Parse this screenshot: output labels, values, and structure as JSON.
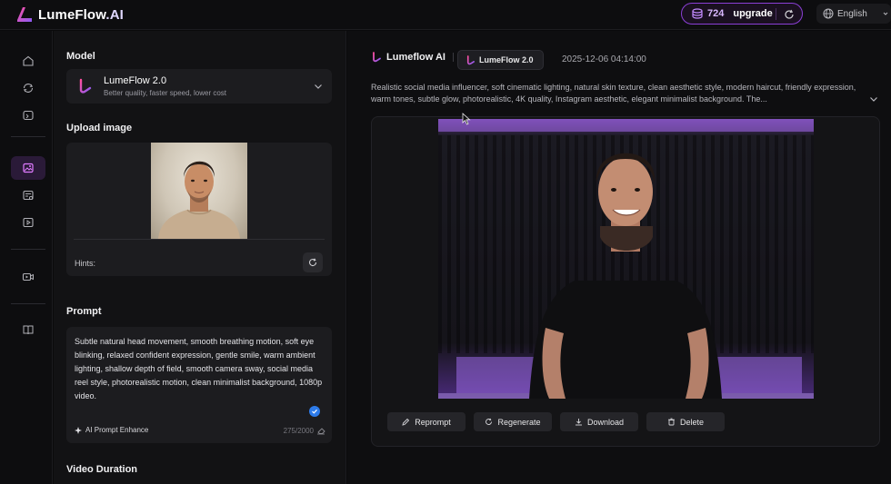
{
  "app": {
    "brand_name": "LumeFlow",
    "brand_suffix": ".AI",
    "accent_color": "#a855f7",
    "brand_gradient": [
      "#ff4fa0",
      "#8b5cf6"
    ]
  },
  "topbar": {
    "credits": "724",
    "upgrade_label": "upgrade",
    "language": "English"
  },
  "rail": {
    "items": [
      {
        "icon": "home-icon"
      },
      {
        "icon": "sync-icon"
      },
      {
        "icon": "folder-icon"
      },
      {
        "icon": "image-icon",
        "active": true
      },
      {
        "icon": "list-settings-icon"
      },
      {
        "icon": "video-file-icon"
      },
      {
        "icon": "video-camera-icon"
      },
      {
        "icon": "book-icon"
      }
    ]
  },
  "panel": {
    "model_label": "Model",
    "model_name": "LumeFlow 2.0",
    "model_desc": "Better quality, faster speed, lower cost",
    "upload_label": "Upload image",
    "hints_label": "Hints:",
    "prompt_label": "Prompt",
    "prompt_text": "Subtle natural head movement, smooth breathing motion, soft eye blinking, relaxed confident expression, gentle smile, warm ambient lighting, shallow depth of field, smooth camera sway, social media reel style, photorealistic motion, clean minimalist background, 1080p video.",
    "enhance_label": "AI Prompt Enhance",
    "char_count": "275/2000",
    "duration_label": "Video Duration"
  },
  "main": {
    "brand": "Lumeflow AI",
    "model_chip": "LumeFlow 2.0",
    "timestamp": "2025-12-06 04:14:00",
    "description": "Realistic social media influencer, soft cinematic lighting, natural skin texture, clean aesthetic style, modern haircut, friendly expression, warm tones, subtle glow, photorealistic, 4K quality, Instagram aesthetic, elegant minimalist background. The...",
    "actions": {
      "reprompt": "Reprompt",
      "regenerate": "Regenerate",
      "download": "Download",
      "delete": "Delete"
    }
  }
}
